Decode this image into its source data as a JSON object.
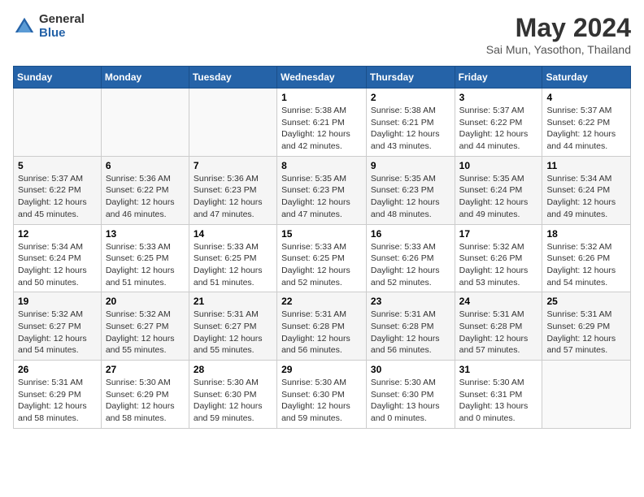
{
  "header": {
    "logo_general": "General",
    "logo_blue": "Blue",
    "title": "May 2024",
    "location": "Sai Mun, Yasothon, Thailand"
  },
  "days_of_week": [
    "Sunday",
    "Monday",
    "Tuesday",
    "Wednesday",
    "Thursday",
    "Friday",
    "Saturday"
  ],
  "weeks": [
    [
      {
        "num": "",
        "info": ""
      },
      {
        "num": "",
        "info": ""
      },
      {
        "num": "",
        "info": ""
      },
      {
        "num": "1",
        "info": "Sunrise: 5:38 AM\nSunset: 6:21 PM\nDaylight: 12 hours\nand 42 minutes."
      },
      {
        "num": "2",
        "info": "Sunrise: 5:38 AM\nSunset: 6:21 PM\nDaylight: 12 hours\nand 43 minutes."
      },
      {
        "num": "3",
        "info": "Sunrise: 5:37 AM\nSunset: 6:22 PM\nDaylight: 12 hours\nand 44 minutes."
      },
      {
        "num": "4",
        "info": "Sunrise: 5:37 AM\nSunset: 6:22 PM\nDaylight: 12 hours\nand 44 minutes."
      }
    ],
    [
      {
        "num": "5",
        "info": "Sunrise: 5:37 AM\nSunset: 6:22 PM\nDaylight: 12 hours\nand 45 minutes."
      },
      {
        "num": "6",
        "info": "Sunrise: 5:36 AM\nSunset: 6:22 PM\nDaylight: 12 hours\nand 46 minutes."
      },
      {
        "num": "7",
        "info": "Sunrise: 5:36 AM\nSunset: 6:23 PM\nDaylight: 12 hours\nand 47 minutes."
      },
      {
        "num": "8",
        "info": "Sunrise: 5:35 AM\nSunset: 6:23 PM\nDaylight: 12 hours\nand 47 minutes."
      },
      {
        "num": "9",
        "info": "Sunrise: 5:35 AM\nSunset: 6:23 PM\nDaylight: 12 hours\nand 48 minutes."
      },
      {
        "num": "10",
        "info": "Sunrise: 5:35 AM\nSunset: 6:24 PM\nDaylight: 12 hours\nand 49 minutes."
      },
      {
        "num": "11",
        "info": "Sunrise: 5:34 AM\nSunset: 6:24 PM\nDaylight: 12 hours\nand 49 minutes."
      }
    ],
    [
      {
        "num": "12",
        "info": "Sunrise: 5:34 AM\nSunset: 6:24 PM\nDaylight: 12 hours\nand 50 minutes."
      },
      {
        "num": "13",
        "info": "Sunrise: 5:33 AM\nSunset: 6:25 PM\nDaylight: 12 hours\nand 51 minutes."
      },
      {
        "num": "14",
        "info": "Sunrise: 5:33 AM\nSunset: 6:25 PM\nDaylight: 12 hours\nand 51 minutes."
      },
      {
        "num": "15",
        "info": "Sunrise: 5:33 AM\nSunset: 6:25 PM\nDaylight: 12 hours\nand 52 minutes."
      },
      {
        "num": "16",
        "info": "Sunrise: 5:33 AM\nSunset: 6:26 PM\nDaylight: 12 hours\nand 52 minutes."
      },
      {
        "num": "17",
        "info": "Sunrise: 5:32 AM\nSunset: 6:26 PM\nDaylight: 12 hours\nand 53 minutes."
      },
      {
        "num": "18",
        "info": "Sunrise: 5:32 AM\nSunset: 6:26 PM\nDaylight: 12 hours\nand 54 minutes."
      }
    ],
    [
      {
        "num": "19",
        "info": "Sunrise: 5:32 AM\nSunset: 6:27 PM\nDaylight: 12 hours\nand 54 minutes."
      },
      {
        "num": "20",
        "info": "Sunrise: 5:32 AM\nSunset: 6:27 PM\nDaylight: 12 hours\nand 55 minutes."
      },
      {
        "num": "21",
        "info": "Sunrise: 5:31 AM\nSunset: 6:27 PM\nDaylight: 12 hours\nand 55 minutes."
      },
      {
        "num": "22",
        "info": "Sunrise: 5:31 AM\nSunset: 6:28 PM\nDaylight: 12 hours\nand 56 minutes."
      },
      {
        "num": "23",
        "info": "Sunrise: 5:31 AM\nSunset: 6:28 PM\nDaylight: 12 hours\nand 56 minutes."
      },
      {
        "num": "24",
        "info": "Sunrise: 5:31 AM\nSunset: 6:28 PM\nDaylight: 12 hours\nand 57 minutes."
      },
      {
        "num": "25",
        "info": "Sunrise: 5:31 AM\nSunset: 6:29 PM\nDaylight: 12 hours\nand 57 minutes."
      }
    ],
    [
      {
        "num": "26",
        "info": "Sunrise: 5:31 AM\nSunset: 6:29 PM\nDaylight: 12 hours\nand 58 minutes."
      },
      {
        "num": "27",
        "info": "Sunrise: 5:30 AM\nSunset: 6:29 PM\nDaylight: 12 hours\nand 58 minutes."
      },
      {
        "num": "28",
        "info": "Sunrise: 5:30 AM\nSunset: 6:30 PM\nDaylight: 12 hours\nand 59 minutes."
      },
      {
        "num": "29",
        "info": "Sunrise: 5:30 AM\nSunset: 6:30 PM\nDaylight: 12 hours\nand 59 minutes."
      },
      {
        "num": "30",
        "info": "Sunrise: 5:30 AM\nSunset: 6:30 PM\nDaylight: 13 hours\nand 0 minutes."
      },
      {
        "num": "31",
        "info": "Sunrise: 5:30 AM\nSunset: 6:31 PM\nDaylight: 13 hours\nand 0 minutes."
      },
      {
        "num": "",
        "info": ""
      }
    ]
  ]
}
